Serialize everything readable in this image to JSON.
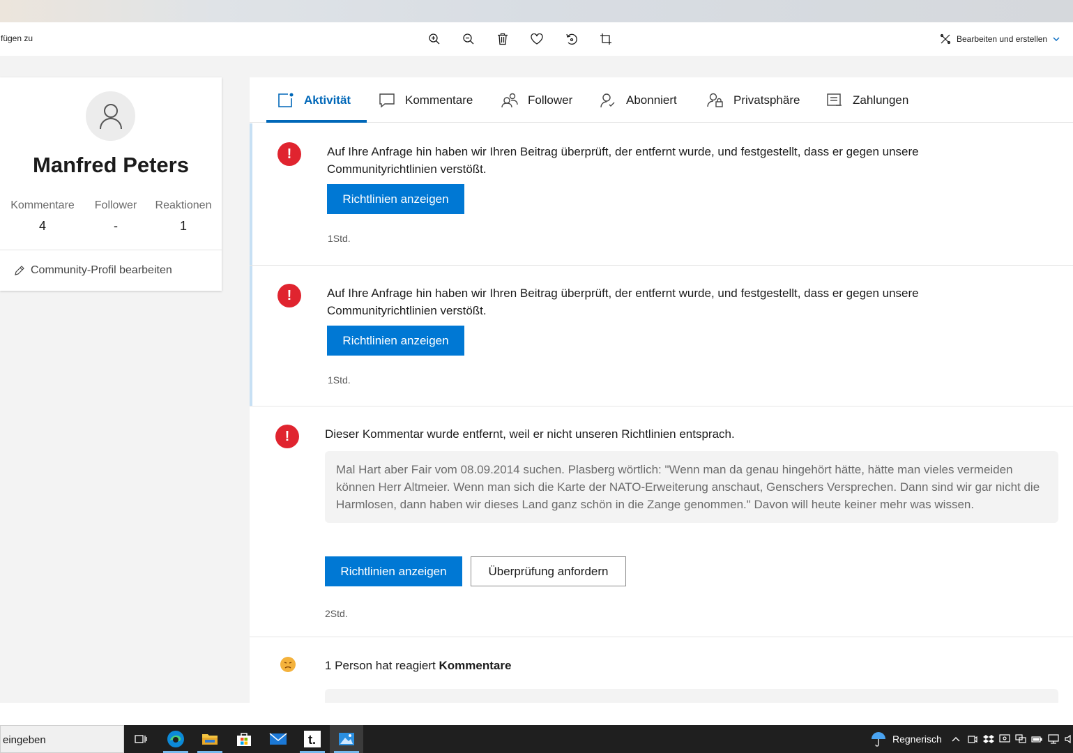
{
  "photo_toolbar": {
    "left_label": "fügen zu",
    "buttons": [
      "zoom-in",
      "zoom-out",
      "delete",
      "favorite",
      "rotate",
      "crop"
    ],
    "edit_create_label": "Bearbeiten und erstellen"
  },
  "profile": {
    "name": "Manfred Peters",
    "stats": [
      {
        "label": "Kommentare",
        "value": "4"
      },
      {
        "label": "Follower",
        "value": "-"
      },
      {
        "label": "Reaktionen",
        "value": "1"
      }
    ],
    "edit_label": "Community-Profil bearbeiten"
  },
  "tabs": [
    {
      "label": "Aktivität",
      "active": true
    },
    {
      "label": "Kommentare",
      "active": false
    },
    {
      "label": "Follower",
      "active": false
    },
    {
      "label": "Abonniert",
      "active": false
    },
    {
      "label": "Privatsphäre",
      "active": false
    },
    {
      "label": "Zahlungen",
      "active": false
    }
  ],
  "activity": [
    {
      "text": "Auf Ihre Anfrage hin haben wir Ihren Beitrag überprüft, der entfernt wurde, und festgestellt, dass er gegen unsere Communityrichtlinien verstößt.",
      "button": "Richtlinien anzeigen",
      "time": "1Std."
    },
    {
      "text": "Auf Ihre Anfrage hin haben wir Ihren Beitrag überprüft, der entfernt wurde, und festgestellt, dass er gegen unsere Communityrichtlinien verstößt.",
      "button": "Richtlinien anzeigen",
      "time": "1Std."
    },
    {
      "text": "Dieser Kommentar wurde entfernt, weil er nicht unseren Richtlinien entsprach.",
      "quote": "Mal Hart aber Fair vom 08.09.2014 suchen. Plasberg wörtlich: \"Wenn man da genau hingehört hätte, hätte man vieles vermeiden können Herr Altmeier. Wenn man sich die Karte der NATO-Erweiterung anschaut, Genschers Versprechen. Dann sind wir gar nicht die Harmlosen, dann haben wir dieses Land ganz schön in die Zange genommen.\" Davon will heute keiner mehr was wissen.",
      "button": "Richtlinien anzeigen",
      "secondary_button": "Überprüfung anfordern",
      "time": "2Std."
    },
    {
      "text_prefix": "1 Person hat reagiert ",
      "text_bold": "Kommentare"
    }
  ],
  "taskbar": {
    "search_text": "eingeben",
    "apps": [
      "task-view",
      "edge",
      "file-explorer",
      "store",
      "mail",
      "t-app",
      "photos"
    ],
    "weather_label": "Regnerisch"
  }
}
